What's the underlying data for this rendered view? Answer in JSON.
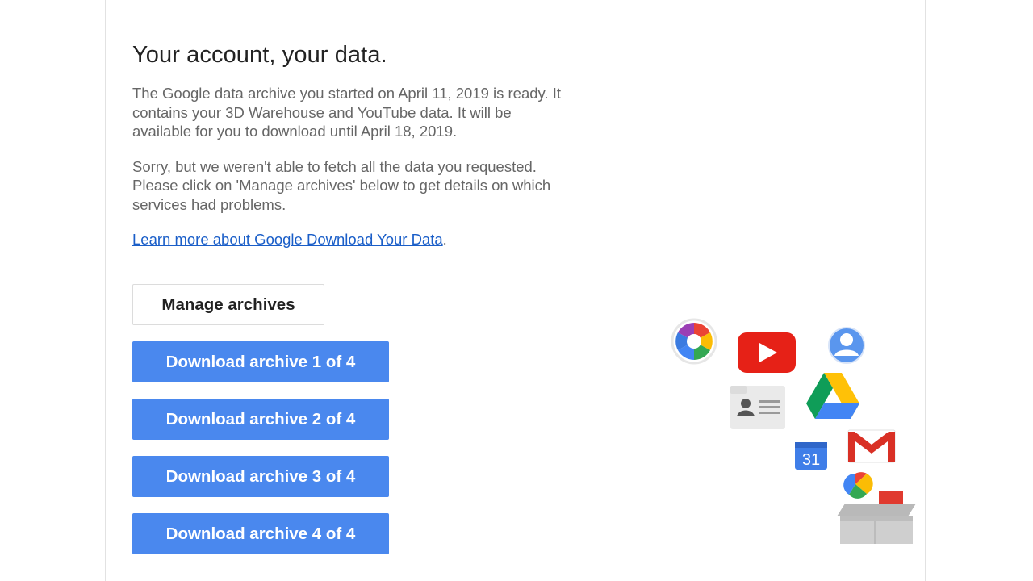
{
  "email": {
    "heading": "Your account, your data.",
    "paragraph_1": "The Google data archive you started on April 11, 2019 is ready. It contains your 3D Warehouse and YouTube data. It will be available for you to download until April 18, 2019.",
    "paragraph_2": "Sorry, but we weren't able to fetch all the data you requested. Please click on 'Manage archives' below to get details on which services had problems.",
    "learn_more_link": "Learn more about Google Download Your Data",
    "learn_more_suffix": "."
  },
  "buttons": {
    "manage_label": "Manage archives",
    "downloads": [
      "Download archive 1 of 4",
      "Download archive 2 of 4",
      "Download archive 3 of 4",
      "Download archive 4 of 4"
    ]
  },
  "illustration": {
    "icons": [
      "picasa-icon",
      "youtube-icon",
      "profile-icon",
      "contacts-card-icon",
      "drive-icon",
      "calendar-icon",
      "gmail-icon",
      "hangouts-icon",
      "archive-box-icon"
    ],
    "calendar_number": "31"
  },
  "colors": {
    "button_blue": "#4a88ee",
    "link_blue": "#1a5ec8",
    "heading_text": "#222222",
    "body_text": "#666666"
  }
}
